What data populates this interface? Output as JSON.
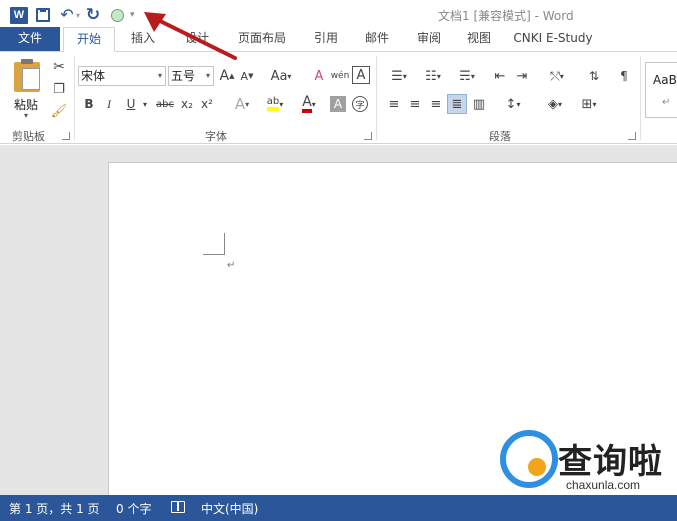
{
  "window": {
    "title": "文档1 [兼容模式] - Word",
    "app_icon": "W"
  },
  "quick_access": {
    "icons": [
      "word-logo-icon",
      "save-icon",
      "undo-icon",
      "redo-icon",
      "circle-icon",
      "customize-qat-icon"
    ]
  },
  "tabs": [
    {
      "label": "文件"
    },
    {
      "label": "开始"
    },
    {
      "label": "插入"
    },
    {
      "label": "设计"
    },
    {
      "label": "页面布局"
    },
    {
      "label": "引用"
    },
    {
      "label": "邮件"
    },
    {
      "label": "审阅"
    },
    {
      "label": "视图"
    },
    {
      "label": "CNKI E-Study"
    }
  ],
  "ribbon": {
    "clipboard": {
      "group_label": "剪贴板",
      "paste_label": "粘贴",
      "paste_arrow": "▾"
    },
    "font": {
      "group_label": "字体",
      "font_name": "宋体",
      "font_size": "五号",
      "grow_label": "A",
      "shrink_label": "A",
      "case_label": "Aa",
      "clear_label": "A",
      "phonetic_label": "wén",
      "border_label": "A",
      "bold": "B",
      "italic": "I",
      "underline": "U",
      "strike": "abc",
      "subscript": "x₂",
      "superscript": "x²",
      "effects": "A",
      "highlight": "ab",
      "font_color": "A",
      "shading": "A",
      "enclose": "字"
    },
    "paragraph": {
      "group_label": "段落"
    },
    "styles": {
      "preview": "AaBl",
      "mark": "↵"
    }
  },
  "document": {
    "paragraph_mark": "↵"
  },
  "status_bar": {
    "pages": "第 1 页，共 1 页",
    "words": "0 个字",
    "language": "中文(中国)"
  },
  "watermark": {
    "text": "查询啦",
    "url": "chaxunla.com"
  },
  "colors": {
    "accent": "#2b579a",
    "arrow": "#b81c1c"
  }
}
